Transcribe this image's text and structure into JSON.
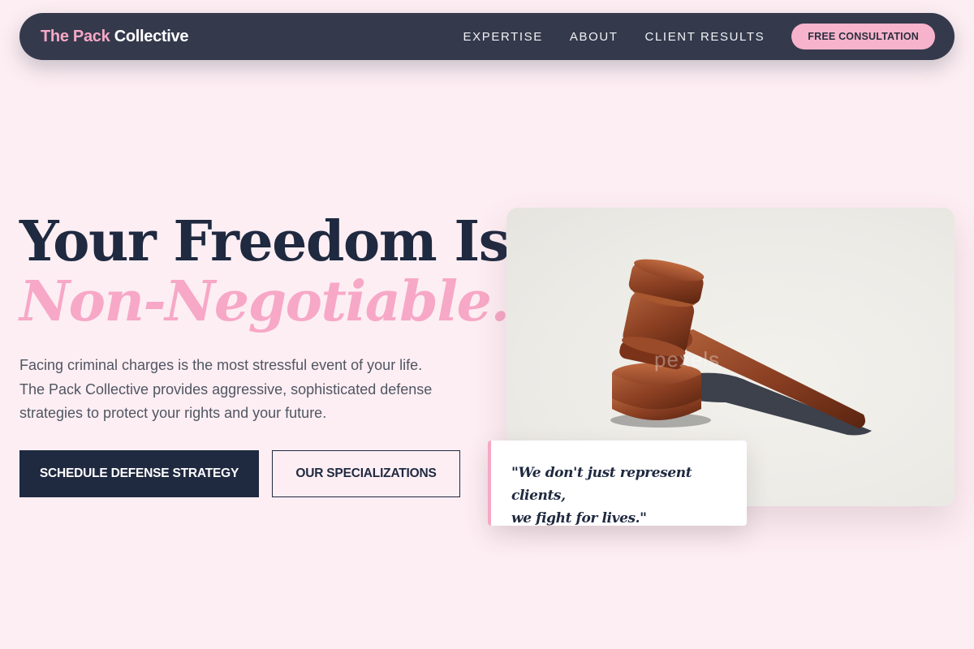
{
  "nav": {
    "brand_part1": "The Pack",
    "brand_part2": "Collective",
    "links": [
      "EXPERTISE",
      "ABOUT",
      "CLIENT RESULTS"
    ],
    "cta_label": "FREE CONSULTATION"
  },
  "hero": {
    "headline_line1": "Your Freedom Is",
    "headline_line2": "Non-Negotiable.",
    "lead": "Facing criminal charges is the most stressful event of your life. The Pack Collective provides aggressive, sophisticated defense strategies to protect your rights and your future.",
    "primary_button": "SCHEDULE DEFENSE STRATEGY",
    "secondary_button": "OUR SPECIALIZATIONS"
  },
  "image": {
    "subject": "wooden-gavel-icon",
    "watermark": "pexels"
  },
  "quote": {
    "line1": "\"We don't just represent clients,",
    "line2": "we fight for lives.\""
  },
  "colors": {
    "background": "#fdeef3",
    "nav": "#343a4c",
    "accent_pink": "#f7a8c6",
    "navy": "#1f2940"
  }
}
